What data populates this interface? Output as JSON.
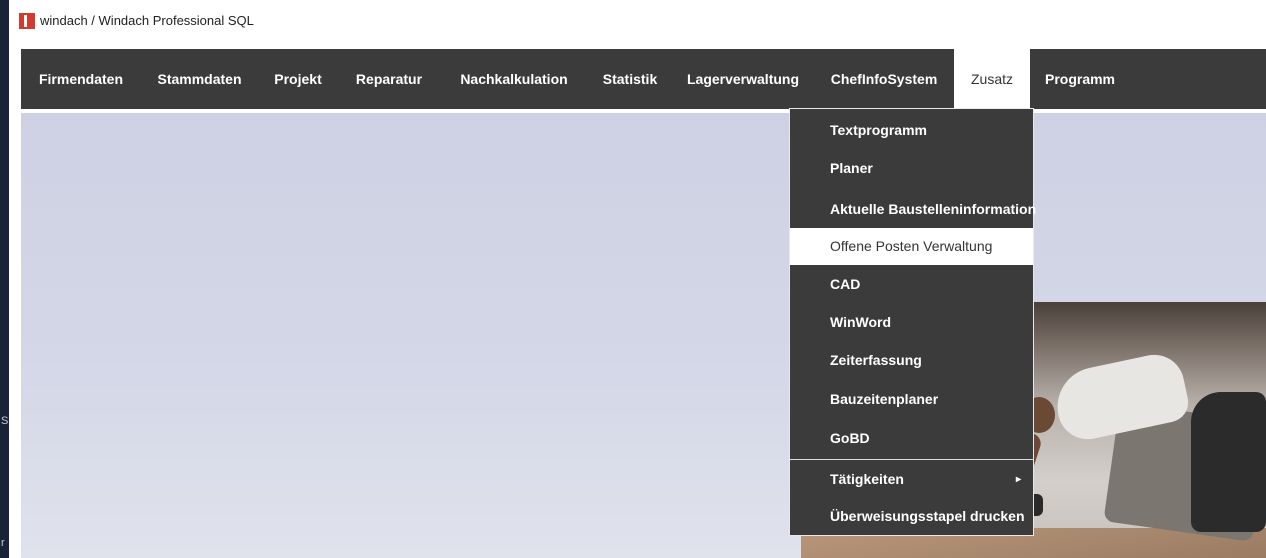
{
  "left_edge": {
    "char1": "S",
    "char2": "r"
  },
  "window": {
    "title": "windach / Windach Professional SQL"
  },
  "menubar": {
    "items": [
      {
        "label": "Firmendaten"
      },
      {
        "label": "Stammdaten"
      },
      {
        "label": "Projekt"
      },
      {
        "label": "Reparatur"
      },
      {
        "label": "Nachkalkulation"
      },
      {
        "label": "Statistik"
      },
      {
        "label": "Lagerverwaltung"
      },
      {
        "label": "ChefInfoSystem"
      },
      {
        "label": "Zusatz",
        "active": true
      },
      {
        "label": "Programm"
      }
    ]
  },
  "dropdown": {
    "items": [
      {
        "label": "Textprogramm"
      },
      {
        "label": "Planer"
      },
      {
        "label": "Aktuelle Baustelleninformation"
      },
      {
        "label": "Offene Posten Verwaltung",
        "highlighted": true
      },
      {
        "label": "CAD"
      },
      {
        "label": "WinWord"
      },
      {
        "label": "Zeiterfassung"
      },
      {
        "label": "Bauzeitenplaner"
      },
      {
        "label": "GoBD"
      },
      {
        "label": "Tätigkeiten",
        "has_submenu": true
      },
      {
        "label": "Überweisungsstapel drucken"
      }
    ],
    "submenu_arrow": "▸"
  },
  "colors": {
    "menubar": "#3b3b3b",
    "highlight": "#ffffff",
    "brand": "#d23a2d"
  }
}
